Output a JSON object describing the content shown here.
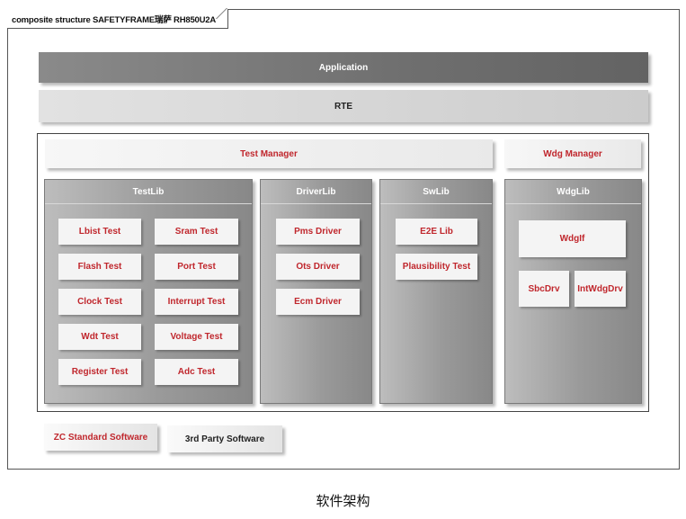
{
  "frame": {
    "title": "composite structure SAFETYFRAME瑞萨 RH850U2A"
  },
  "layers": {
    "application": "Application",
    "rte": "RTE"
  },
  "managers": {
    "test_manager": "Test Manager",
    "wdg_manager": "Wdg Manager"
  },
  "groups": {
    "testlib": {
      "title": "TestLib",
      "items": [
        "Lbist Test",
        "Sram Test",
        "Flash Test",
        "Port Test",
        "Clock Test",
        "Interrupt Test",
        "Wdt Test",
        "Voltage Test",
        "Register Test",
        "Adc Test"
      ]
    },
    "driverlib": {
      "title": "DriverLib",
      "items": [
        "Pms Driver",
        "Ots Driver",
        "Ecm Driver"
      ]
    },
    "swlib": {
      "title": "SwLib",
      "items": [
        "E2E Lib",
        "Plausibility Test"
      ]
    },
    "wdglib": {
      "title": "WdgLib",
      "items": [
        "WdgIf",
        "SbcDrv",
        "IntWdgDrv"
      ]
    }
  },
  "legend": {
    "zc_standard": "ZC Standard Software",
    "third_party": "3rd Party Software"
  },
  "caption": "软件架构",
  "colors": {
    "accent_red": "#c0272d",
    "application_bar": "#6f6f6f",
    "rte_bar": "#d4d4d4",
    "group_fill": "#9a9a9a"
  }
}
